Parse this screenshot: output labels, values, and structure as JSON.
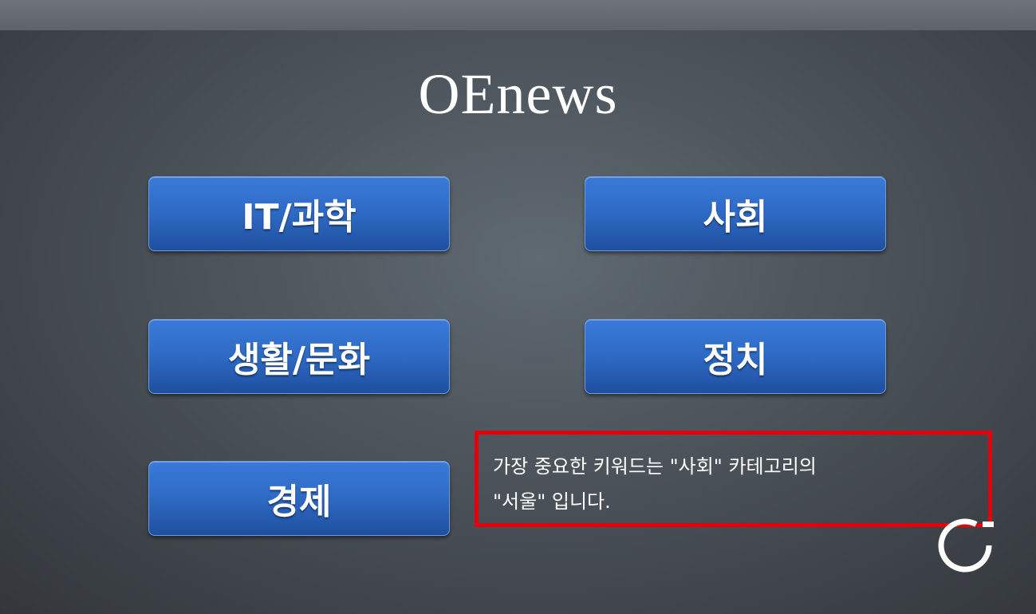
{
  "app": {
    "title": "OEnews"
  },
  "categories": {
    "it_science": "IT/과학",
    "society": "사회",
    "life_culture": "생활/문화",
    "politics": "정치",
    "economy": "경제"
  },
  "keyword_box": {
    "line1": "가장 중요한 키워드는 \"사회\" 카테고리의",
    "line2": "\"서울\" 입니다."
  },
  "icons": {
    "refresh": "refresh-icon"
  },
  "colors": {
    "button": "#2f6cc7",
    "highlight_border": "#e6000a",
    "text": "#ffffff"
  }
}
